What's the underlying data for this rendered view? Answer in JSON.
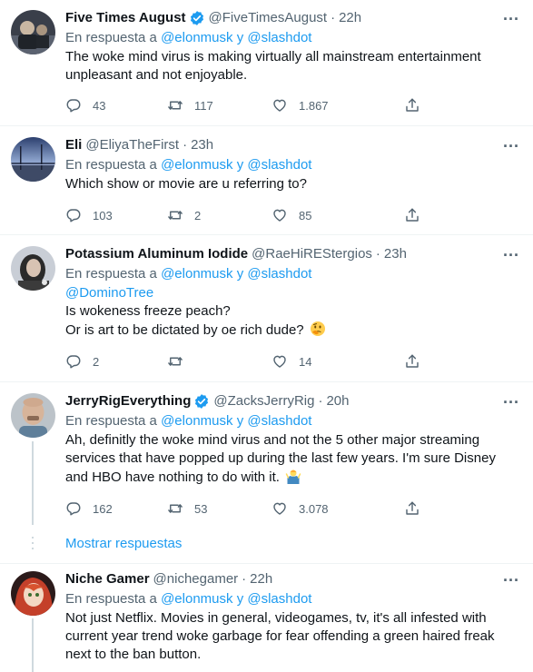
{
  "colors": {
    "link": "#1d9bf0",
    "secondary": "#536471",
    "text": "#0f1419",
    "divider": "#eff3f4"
  },
  "tweets": [
    {
      "name": "Five Times August",
      "verified": true,
      "handle": "@FiveTimesAugust",
      "time": "22h",
      "reply_prefix": "En respuesta a",
      "mention1": "@elonmusk",
      "conj": "y",
      "mention2": "@slashdot",
      "lines": [
        "The woke mind virus is making virtually all mainstream entertainment unpleasant and not enjoyable."
      ],
      "replies": "43",
      "retweets": "117",
      "likes": "1.867"
    },
    {
      "name": "Eli",
      "verified": false,
      "handle": "@EliyaTheFirst",
      "time": "23h",
      "reply_prefix": "En respuesta a",
      "mention1": "@elonmusk",
      "conj": "y",
      "mention2": "@slashdot",
      "lines": [
        "Which show or movie are u referring to?"
      ],
      "replies": "103",
      "retweets": "2",
      "likes": "85"
    },
    {
      "name": "Potassium Aluminum Iodide",
      "verified": false,
      "handle": "@RaeHiREStergios",
      "time": "23h",
      "reply_prefix": "En respuesta a",
      "mention1": "@elonmusk",
      "conj": "y",
      "mention2": "@slashdot",
      "mention_line": "@DominoTree",
      "lines": [
        "Is wokeness freeze peach?",
        "Or is art to be dictated by oe rich dude?"
      ],
      "emoji_icon": "thinking-face-emoji",
      "replies": "2",
      "retweets": "",
      "likes": "14"
    },
    {
      "name": "JerryRigEverything",
      "verified": true,
      "handle": "@ZacksJerryRig",
      "time": "20h",
      "reply_prefix": "En respuesta a",
      "mention1": "@elonmusk",
      "conj": "y",
      "mention2": "@slashdot",
      "lines": [
        "Ah, definitly the woke mind virus and not the 5 other major streaming services that have popped up during the last few years. I'm sure Disney and HBO have nothing to do with it."
      ],
      "emoji_icon": "person-shrugging-emoji",
      "replies": "162",
      "retweets": "53",
      "likes": "3.078"
    },
    {
      "name": "Niche Gamer",
      "verified": false,
      "handle": "@nichegamer",
      "time": "22h",
      "reply_prefix": "En respuesta a",
      "mention1": "@elonmusk",
      "conj": "y",
      "mention2": "@slashdot",
      "lines": [
        "Not just Netflix. Movies in general, videogames, tv, it's all infested with current year trend woke garbage for fear offending a green haired freak next to the ban button."
      ]
    }
  ],
  "show_replies": "Mostrar respuestas",
  "icons": {
    "reply": "reply-icon",
    "retweet": "retweet-icon",
    "like": "heart-icon",
    "share": "share-icon",
    "more": "more-icon",
    "verified": "verified-badge-icon"
  }
}
